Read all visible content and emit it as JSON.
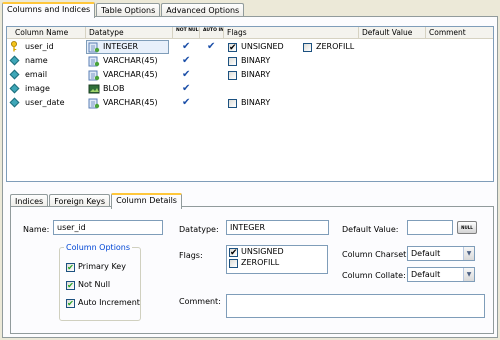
{
  "tabs": [
    "Columns and Indices",
    "Table Options",
    "Advanced Options"
  ],
  "columns_header": {
    "name": "Column Name",
    "datatype": "Datatype",
    "not_null": "NOT NULL",
    "auto_inc": "AUTO INC",
    "flags": "Flags",
    "default_value": "Default Value",
    "comment": "Comment"
  },
  "columns": [
    {
      "name": "user_id",
      "icon": "key-icon",
      "datatype": "INTEGER",
      "not_null": true,
      "auto_inc": true,
      "flags": [
        {
          "label": "UNSIGNED",
          "checked": true
        },
        {
          "label": "ZEROFILL",
          "checked": false
        }
      ]
    },
    {
      "name": "name",
      "icon": "diamond-icon",
      "datatype": "VARCHAR(45)",
      "not_null": true,
      "auto_inc": false,
      "flags": [
        {
          "label": "BINARY",
          "checked": false
        }
      ]
    },
    {
      "name": "email",
      "icon": "diamond-icon",
      "datatype": "VARCHAR(45)",
      "not_null": true,
      "auto_inc": false,
      "flags": [
        {
          "label": "BINARY",
          "checked": false
        }
      ]
    },
    {
      "name": "image",
      "icon": "diamond-icon",
      "datatype": "BLOB",
      "not_null": true,
      "auto_inc": false,
      "flags": []
    },
    {
      "name": "user_date",
      "icon": "diamond-icon",
      "datatype": "VARCHAR(45)",
      "not_null": true,
      "auto_inc": false,
      "flags": [
        {
          "label": "BINARY",
          "checked": false
        }
      ]
    }
  ],
  "bottom_tabs": [
    "Indices",
    "Foreign Keys",
    "Column Details"
  ],
  "details": {
    "name_label": "Name:",
    "name_value": "user_id",
    "column_options_legend": "Column Options",
    "options": [
      {
        "label": "Primary Key",
        "checked": true
      },
      {
        "label": "Not Null",
        "checked": true
      },
      {
        "label": "Auto Increment",
        "checked": true
      }
    ],
    "datatype_label": "Datatype:",
    "datatype_value": "INTEGER",
    "flags_label": "Flags:",
    "flags": [
      {
        "label": "UNSIGNED",
        "checked": true
      },
      {
        "label": "ZEROFILL",
        "checked": false
      }
    ],
    "comment_label": "Comment:",
    "comment_value": "",
    "default_value_label": "Default Value:",
    "default_value": "",
    "null_button": "NULL",
    "charset_label": "Column Charset:",
    "charset_value": "Default",
    "collate_label": "Column Collate:",
    "collate_value": "Default"
  },
  "colors": {
    "background": "#ece9d8",
    "active_tab_accent": "#ffc73c",
    "checkmark": "#1c4fa8",
    "checkbox_check": "#21a121",
    "field_border": "#7f9db9",
    "legend_text": "#0046d5"
  }
}
